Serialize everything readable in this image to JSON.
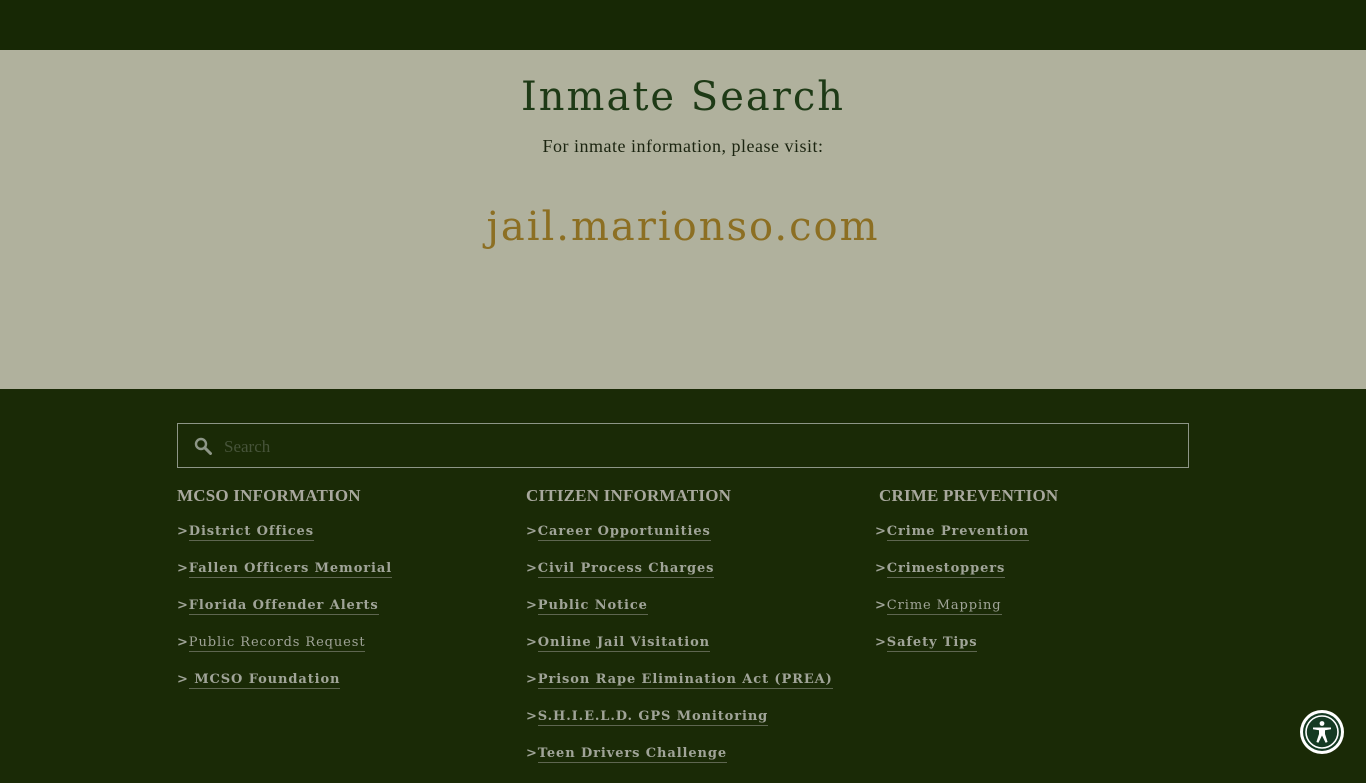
{
  "hero": {
    "title": "Inmate Search",
    "subtitle": "For inmate information, please visit:",
    "link": "jail.marionso.com"
  },
  "search": {
    "placeholder": "Search",
    "icon": "search-icon"
  },
  "columns": [
    {
      "heading": "MCSO INFORMATION",
      "links": [
        "District Offices",
        "Fallen Officers Memorial ",
        "Florida Offender Alerts",
        "Public Records Request",
        " MCSO Foundation "
      ]
    },
    {
      "heading": "CITIZEN INFORMATION",
      "links": [
        "Career Opportunities ",
        "Civil Process Charges",
        "Public Notice",
        "Online Jail Visitation",
        "Prison Rape Elimination Act (PREA)",
        "S.H.I.E.L.D. GPS Monitoring",
        "Teen Drivers Challenge"
      ]
    },
    {
      "heading": "CRIME PREVENTION",
      "links": [
        "Crime Prevention",
        "Crimestoppers",
        "Crime Mapping",
        "Safety Tips"
      ]
    }
  ],
  "link_prefix": ">",
  "accessibility": {
    "icon": "accessibility-icon"
  },
  "colors": {
    "top_bar": "#172805",
    "hero_bg": "#b0b19d",
    "title": "#1e3a16",
    "link": "#8c6f23",
    "footer_bg": "#1a2a06"
  }
}
